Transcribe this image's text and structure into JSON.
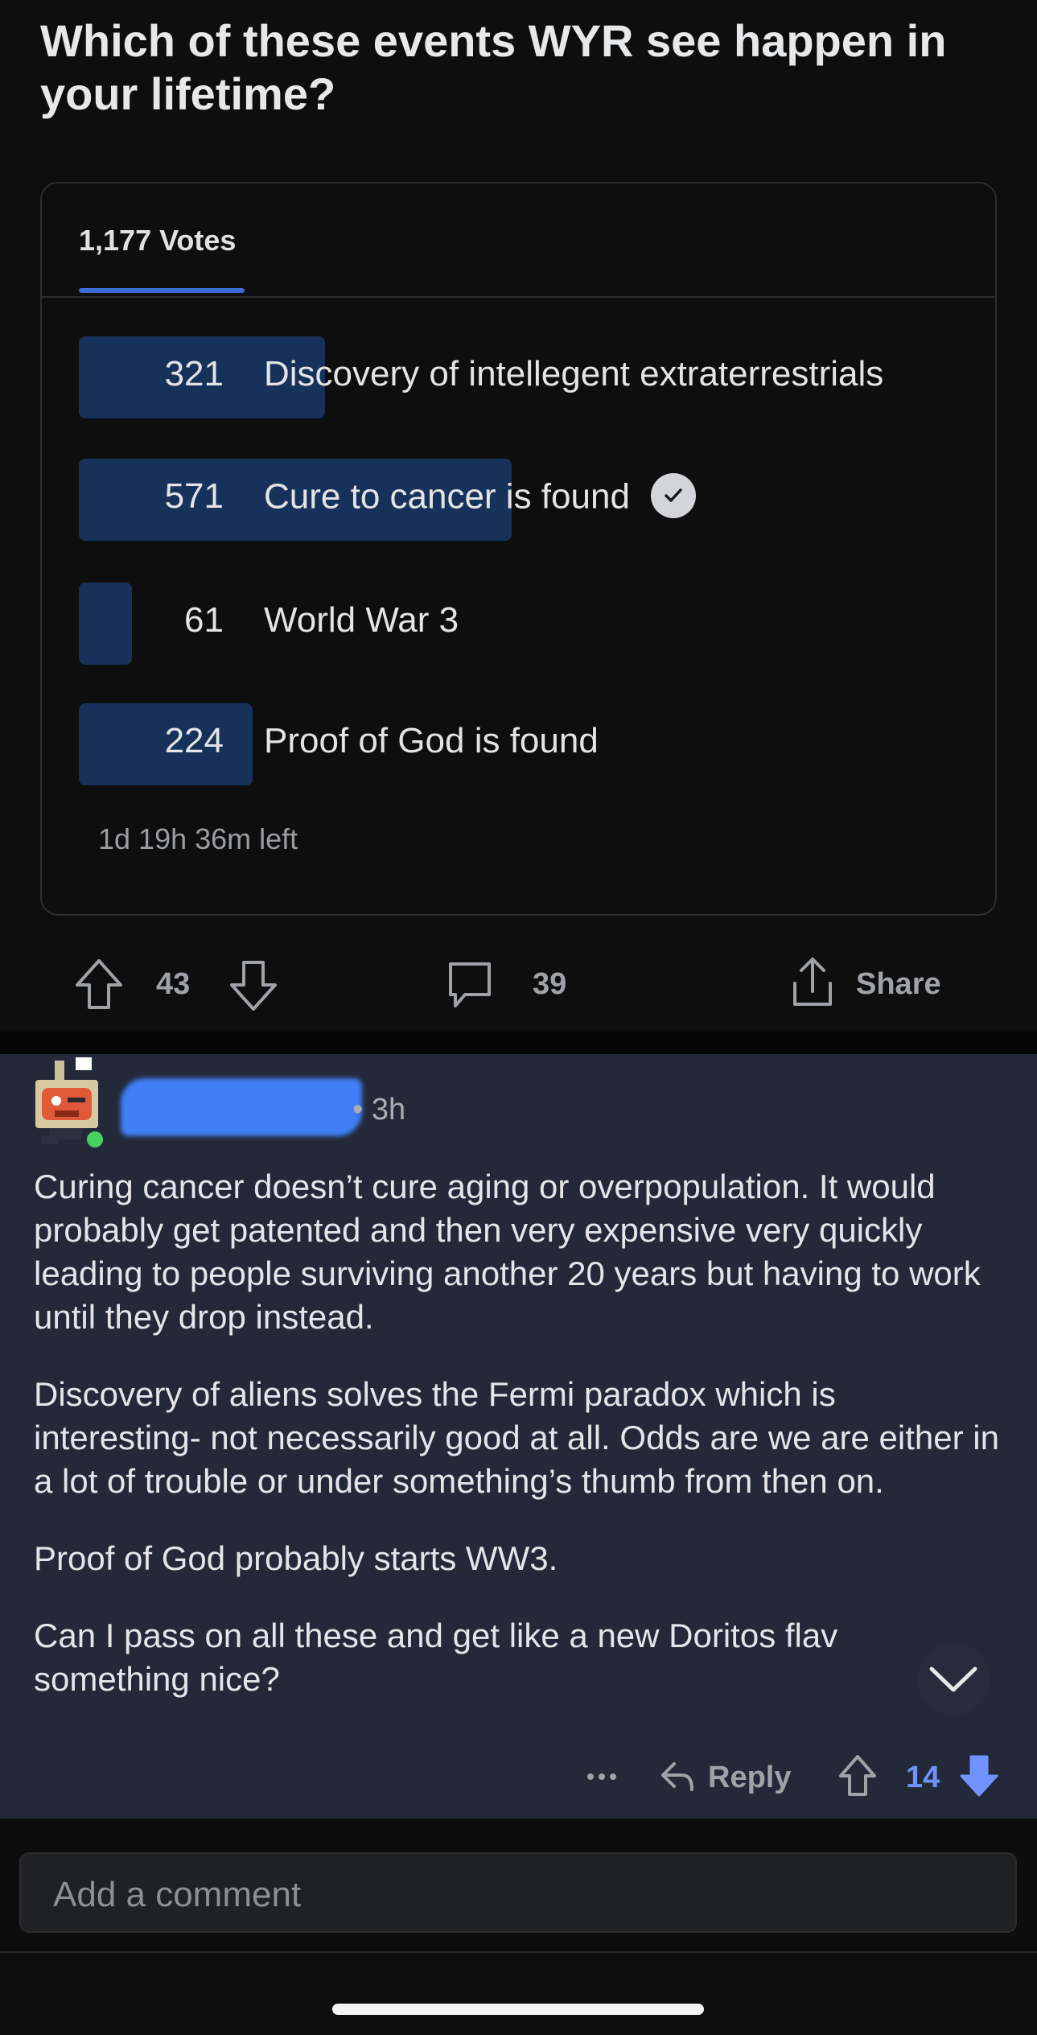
{
  "post": {
    "title": "Which of these events WYR see happen in your lifetime?"
  },
  "poll": {
    "votes_label": "1,177 Votes",
    "time_left": "1d 19h 36m left",
    "options": [
      {
        "count": "321",
        "label": "Discovery of intellegent extraterrestrials",
        "share": 0.273
      },
      {
        "count": "571",
        "label": "Cure to cancer is found",
        "share": 0.485,
        "selected": true
      },
      {
        "count": "61",
        "label": "World War 3",
        "share": 0.052
      },
      {
        "count": "224",
        "label": "Proof of God is found",
        "share": 0.19
      }
    ],
    "bar_color": "#17325a",
    "accent_color": "#3a6ed6"
  },
  "post_actions": {
    "upvotes": "43",
    "comments": "39",
    "share_label": "Share"
  },
  "comment": {
    "time": "• 3h",
    "paragraphs": [
      "Curing cancer doesn’t cure aging or overpopulation. It would probably get patented and then very expensive very quickly leading to people surviving another 20 years but having to work until they drop instead.",
      "Discovery of aliens solves the Fermi paradox which is interesting- not necessarily good at all. Odds are we are either in a lot of trouble or under something’s thumb from then on.",
      "Proof of God probably starts WW3.",
      "Can I pass on all these and get like a new Doritos flav something nice?"
    ],
    "reply_label": "Reply",
    "score": "14",
    "score_color": "#7193ff",
    "online_color": "#46d160"
  },
  "composer": {
    "placeholder": "Add a comment"
  }
}
